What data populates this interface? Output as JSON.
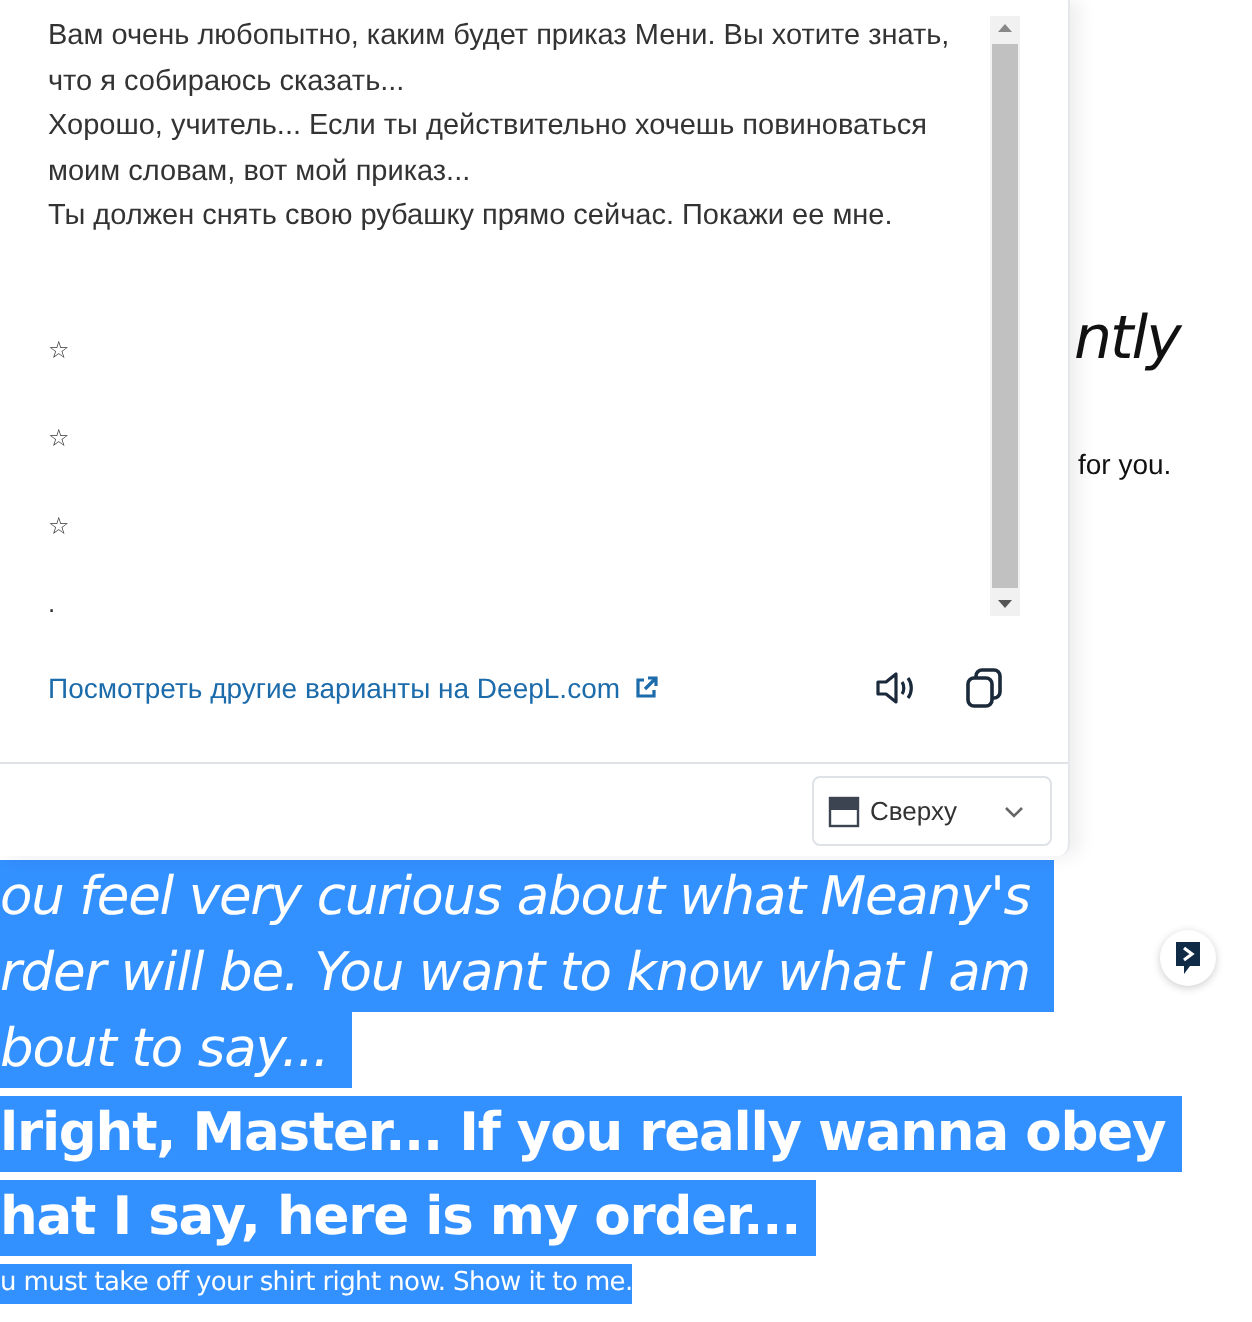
{
  "translation_popup": {
    "lines": [
      "Вам очень любопытно, каким будет приказ Мени. Вы хотите знать,",
      "что я собираюсь сказать...",
      "Хорошо, учитель... Если ты действительно хочешь повиноваться",
      "моим словам, вот мой приказ...",
      "Ты должен снять свою рубашку прямо сейчас. Покажи ее мне."
    ],
    "stars": [
      "☆",
      "☆",
      "☆"
    ],
    "cut_line": ".",
    "link": "Посмотреть другие варианты на DeepL.com",
    "position_select": {
      "value": "Сверху"
    }
  },
  "page": {
    "heading_fragment": "ntly",
    "text_fragment": "for you.",
    "selected_text": [
      {
        "kind": "italic",
        "text": "ou feel very curious about what Meany's"
      },
      {
        "kind": "italic",
        "text": "rder will be. You want to know what I am"
      },
      {
        "kind": "italic",
        "text": "bout to say..."
      },
      {
        "kind": "large",
        "text": "lright, Master... If you really wanna obey"
      },
      {
        "kind": "large",
        "text": "hat I say, here is my order..."
      },
      {
        "kind": "small",
        "text": "u must take off your shirt right now. Show it to me."
      }
    ]
  }
}
